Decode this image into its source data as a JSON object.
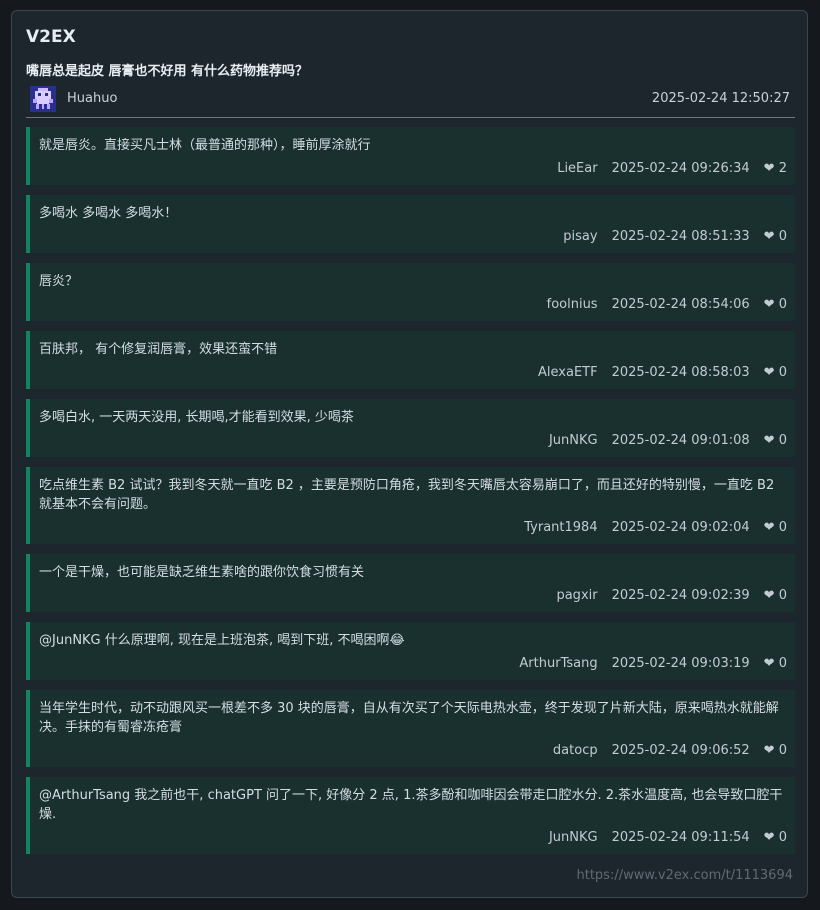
{
  "site": "V2EX",
  "topic": {
    "title": "嘴唇总是起皮 唇膏也不好用 有什么药物推荐吗？",
    "author": "Huahuo",
    "time": "2025-02-24 12:50:27"
  },
  "replies": [
    {
      "text": "就是唇炎。直接买凡士林（最普通的那种），睡前厚涂就行",
      "user": "LieEar",
      "time": "2025-02-24 09:26:34",
      "likes": "2"
    },
    {
      "text": "多喝水 多喝水 多喝水！",
      "user": "pisay",
      "time": "2025-02-24 08:51:33",
      "likes": "0"
    },
    {
      "text": "唇炎？",
      "user": "foolnius",
      "time": "2025-02-24 08:54:06",
      "likes": "0"
    },
    {
      "text": "百肤邦， 有个修复润唇膏，效果还蛮不错",
      "user": "AlexaETF",
      "time": "2025-02-24 08:58:03",
      "likes": "0"
    },
    {
      "text": "多喝白水, 一天两天没用, 长期喝,才能看到效果, 少喝茶",
      "user": "JunNKG",
      "time": "2025-02-24 09:01:08",
      "likes": "0"
    },
    {
      "text": "吃点维生素 B2 试试？我到冬天就一直吃 B2 ，主要是预防口角疮，我到冬天嘴唇太容易崩口了，而且还好的特别慢，一直吃 B2 就基本不会有问题。",
      "user": "Tyrant1984",
      "time": "2025-02-24 09:02:04",
      "likes": "0"
    },
    {
      "text": "一个是干燥，也可能是缺乏维生素啥的跟你饮食习惯有关",
      "user": "pagxir",
      "time": "2025-02-24 09:02:39",
      "likes": "0"
    },
    {
      "text": "@JunNKG 什么原理啊, 现在是上班泡茶, 喝到下班, 不喝困啊😂",
      "user": "ArthurTsang",
      "time": "2025-02-24 09:03:19",
      "likes": "0"
    },
    {
      "text": "当年学生时代，动不动跟风买一根差不多 30 块的唇膏，自从有次买了个天际电热水壶，终于发现了片新大陆，原来喝热水就能解决。手抹的有蜀睿冻疮膏",
      "user": "datocp",
      "time": "2025-02-24 09:06:52",
      "likes": "0"
    },
    {
      "text": "@ArthurTsang 我之前也干, chatGPT 问了一下, 好像分 2 点, 1.茶多酚和咖啡因会带走口腔水分. 2.茶水温度高, 也会导致口腔干燥.",
      "user": "JunNKG",
      "time": "2025-02-24 09:11:54",
      "likes": "0"
    }
  ],
  "heart_icon": "❤",
  "footer_url": "https://www.v2ex.com/t/1113694"
}
